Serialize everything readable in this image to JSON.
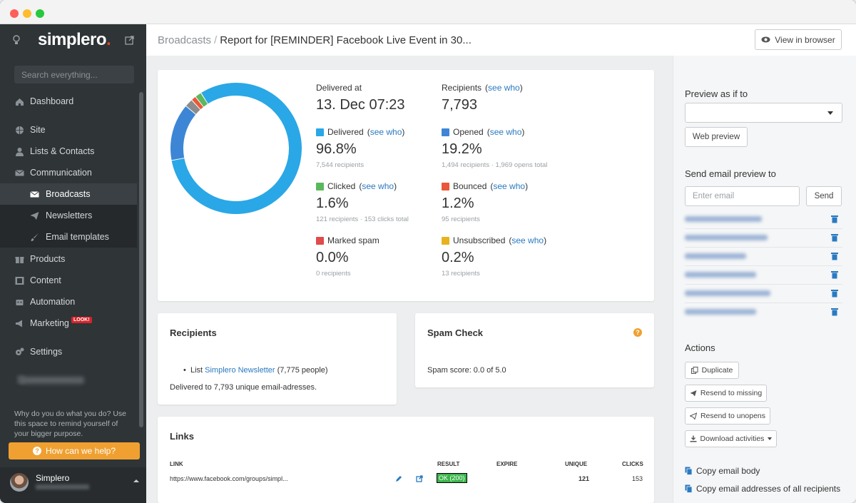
{
  "window": {
    "title": ""
  },
  "sidebar": {
    "logo": "simplero",
    "logo_dot": ".",
    "search_placeholder": "Search everything...",
    "items": [
      {
        "label": "Dashboard",
        "icon": "home-icon"
      },
      {
        "label": "Site",
        "icon": "globe-icon"
      },
      {
        "label": "Lists & Contacts",
        "icon": "user-icon"
      },
      {
        "label": "Communication",
        "icon": "envelope-icon"
      },
      {
        "label": "Broadcasts",
        "icon": "envelope-icon"
      },
      {
        "label": "Newsletters",
        "icon": "paper-plane-icon"
      },
      {
        "label": "Email templates",
        "icon": "brush-icon"
      },
      {
        "label": "Products",
        "icon": "gift-icon"
      },
      {
        "label": "Content",
        "icon": "film-icon"
      },
      {
        "label": "Automation",
        "icon": "robot-icon"
      },
      {
        "label": "Marketing",
        "icon": "megaphone-icon"
      },
      {
        "label": "Settings",
        "icon": "gears-icon"
      }
    ],
    "marketing_badge": "LOOK!",
    "purpose_text": "Why do you do what you do? Use this space to remind yourself of your bigger purpose.",
    "help_button": "How can we help?",
    "user_name": "Simplero"
  },
  "header": {
    "breadcrumb_link": "Broadcasts",
    "breadcrumb_sep": "/",
    "title": "Report for [REMINDER] Facebook Live Event in 30...",
    "view_button": "View in browser"
  },
  "colors": {
    "delivered": "#2aa7e6",
    "opened": "#3d86d6",
    "clicked": "#5cb85c",
    "bounced": "#e9583a",
    "spam": "#e04b4b",
    "unsubscribed": "#e8b21f",
    "accent": "#2a7ac0",
    "help": "#f0a030"
  },
  "chart_data": {
    "type": "pie",
    "categories": [
      "Delivered",
      "Opened",
      "Other 1",
      "Bounced",
      "Clicked"
    ],
    "values": [
      80.5,
      14.0,
      2.0,
      1.2,
      1.6
    ]
  },
  "stats": {
    "delivered_at_label": "Delivered at",
    "delivered_at_value": "13. Dec 07:23",
    "recipients_label": "Recipients",
    "recipients_value": "7,793",
    "see_who": "see who",
    "delivered_label": "Delivered",
    "delivered_value": "96.8%",
    "delivered_sub": "7,544 recipients",
    "opened_label": "Opened",
    "opened_value": "19.2%",
    "opened_sub": "1,494 recipients · 1,969 opens total",
    "clicked_label": "Clicked",
    "clicked_value": "1.6%",
    "clicked_sub": "121 recipients · 153 clicks total",
    "bounced_label": "Bounced",
    "bounced_value": "1.2%",
    "bounced_sub": "95 recipients",
    "spam_label": "Marked spam",
    "spam_value": "0.0%",
    "spam_sub": "0 recipients",
    "unsub_label": "Unsubscribed",
    "unsub_value": "0.2%",
    "unsub_sub": "13 recipients"
  },
  "recipients_card": {
    "title": "Recipients",
    "list_prefix": "List",
    "list_link": "Simplero Newsletter",
    "list_suffix": "(7,775 people)",
    "delivered_text": "Delivered to 7,793 unique email-adresses."
  },
  "spam_card": {
    "title": "Spam Check",
    "score": "Spam score: 0.0 of 5.0"
  },
  "links_card": {
    "title": "Links",
    "headers": {
      "link": "LINK",
      "result": "RESULT",
      "expire": "EXPIRE",
      "unique": "UNIQUE",
      "clicks": "CLICKS"
    },
    "rows": [
      {
        "link": "https://www.facebook.com/groups/simpl...",
        "result": "OK (200)",
        "expire": "",
        "unique": "121",
        "clicks": "153"
      }
    ]
  },
  "right_panel": {
    "preview_as_label": "Preview as if to",
    "web_preview": "Web preview",
    "send_preview_label": "Send email preview to",
    "email_placeholder": "Enter email",
    "send_button": "Send",
    "actions_label": "Actions",
    "duplicate": "Duplicate",
    "resend_missing": "Resend to missing",
    "resend_unopens": "Resend to unopens",
    "download": "Download activities",
    "copy_body": "Copy email body",
    "copy_addresses": "Copy email addresses of all recipients"
  }
}
